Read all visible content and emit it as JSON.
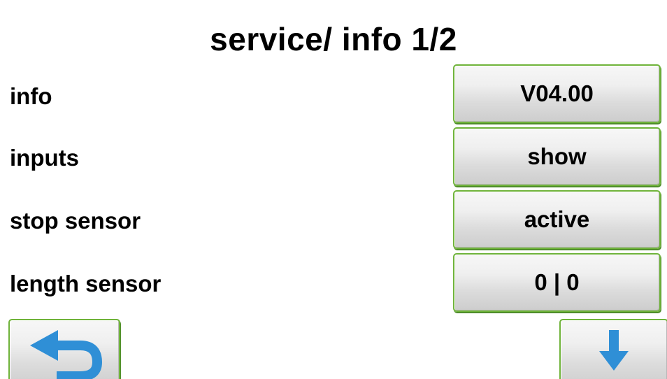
{
  "screen": {
    "title": "service/ info 1/2"
  },
  "rows": [
    {
      "label": "info",
      "value": "V04.00"
    },
    {
      "label": "inputs",
      "value": "show"
    },
    {
      "label": "stop sensor",
      "value": "active"
    },
    {
      "label": "length sensor",
      "value": "0 | 0"
    }
  ],
  "navigation": {
    "back_icon": "return-arrow-icon",
    "down_icon": "arrow-down-icon"
  },
  "colors": {
    "button_border": "#6fb33a",
    "icon_blue": "#2f8fd6",
    "background": "#ffffff"
  }
}
